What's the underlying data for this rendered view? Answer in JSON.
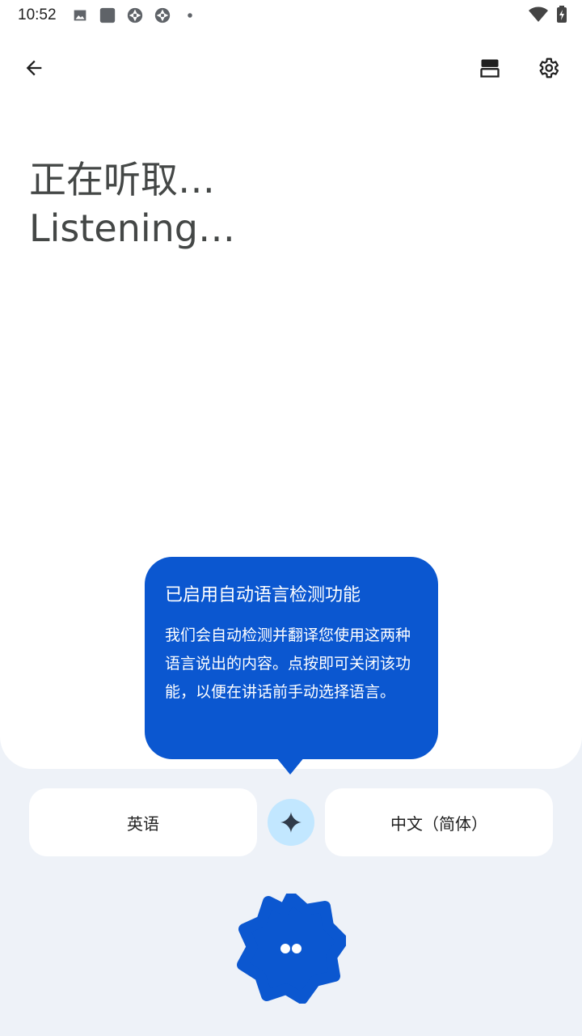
{
  "status_bar": {
    "time": "10:52"
  },
  "toolbar": {
    "back_icon": "arrow-back-icon",
    "layout_icon": "split-layout-icon",
    "settings_icon": "gear-icon"
  },
  "transcript": {
    "line_zh": "正在听取…",
    "line_en": "Listening…"
  },
  "tooltip": {
    "title": "已启用自动语言检测功能",
    "body": "我们会自动检测并翻译您使用这两种语言说出的内容。点按即可关闭该功能，以便在讲话前手动选择语言。"
  },
  "languages": {
    "source": "英语",
    "target": "中文（简体）",
    "swap_icon": "sparkle-icon"
  },
  "mic": {
    "icon": "listening-dots-icon"
  },
  "colors": {
    "accent": "#0b57d0",
    "swap_bg": "#c2e7ff",
    "page_bg": "#eef2f8"
  }
}
